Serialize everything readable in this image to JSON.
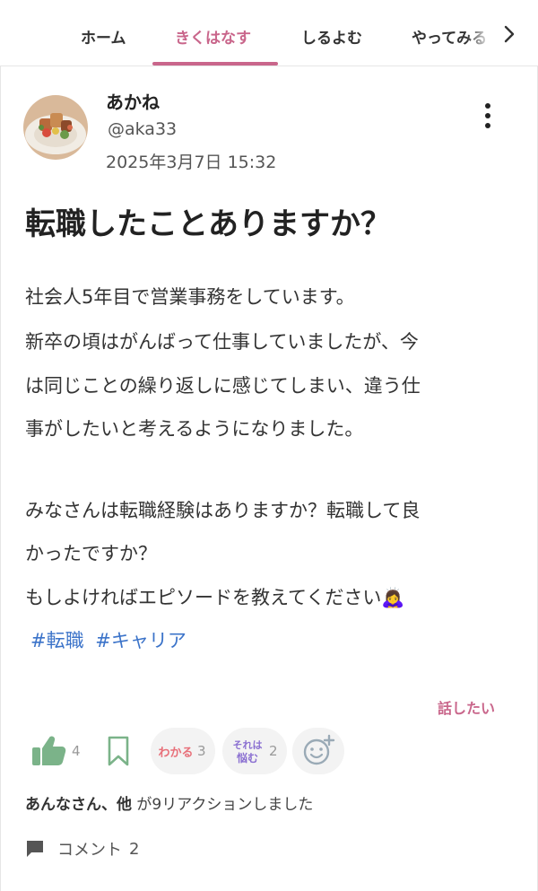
{
  "tabs": [
    {
      "label": "ホーム",
      "active": false
    },
    {
      "label": "きくはなす",
      "active": true
    },
    {
      "label": "しるよむ",
      "active": false
    },
    {
      "label": "やってみる",
      "active": false
    }
  ],
  "post": {
    "author_name": "あかね",
    "handle": "@aka33",
    "timestamp": "2025年3月7日 15:32",
    "title": "転職したことありますか？",
    "body_lines": [
      "社会人5年目で営業事務をしています。",
      "新卒の頃はがんばって仕事していましたが、今",
      "は同じことの繰り返しに感じてしまい、違う仕",
      "事がしたいと考えるようになりました。",
      "",
      "みなさんは転職経験はありますか？転職して良",
      "かったですか？",
      "もしよければエピソードを教えてください"
    ],
    "emoji": "🙇‍♀️",
    "hashtags": [
      "#転職",
      "#キャリア"
    ],
    "talk_link": "話したい"
  },
  "reactions": {
    "like_count": "4",
    "wakaru_label": "わかる",
    "wakaru_count": "3",
    "nayamu_label_line1": "それは",
    "nayamu_label_line2": "悩む",
    "nayamu_count": "2",
    "summary_names": "あんなさん、他",
    "summary_text": " が9リアクションしました"
  },
  "comments": {
    "label": "コメント",
    "count": "2"
  },
  "colors": {
    "accent": "#c9668b",
    "link": "#3b73c9",
    "like_green": "#7bb389",
    "wakaru_red": "#e8707a",
    "nayamu_purple": "#8a6fd1"
  }
}
